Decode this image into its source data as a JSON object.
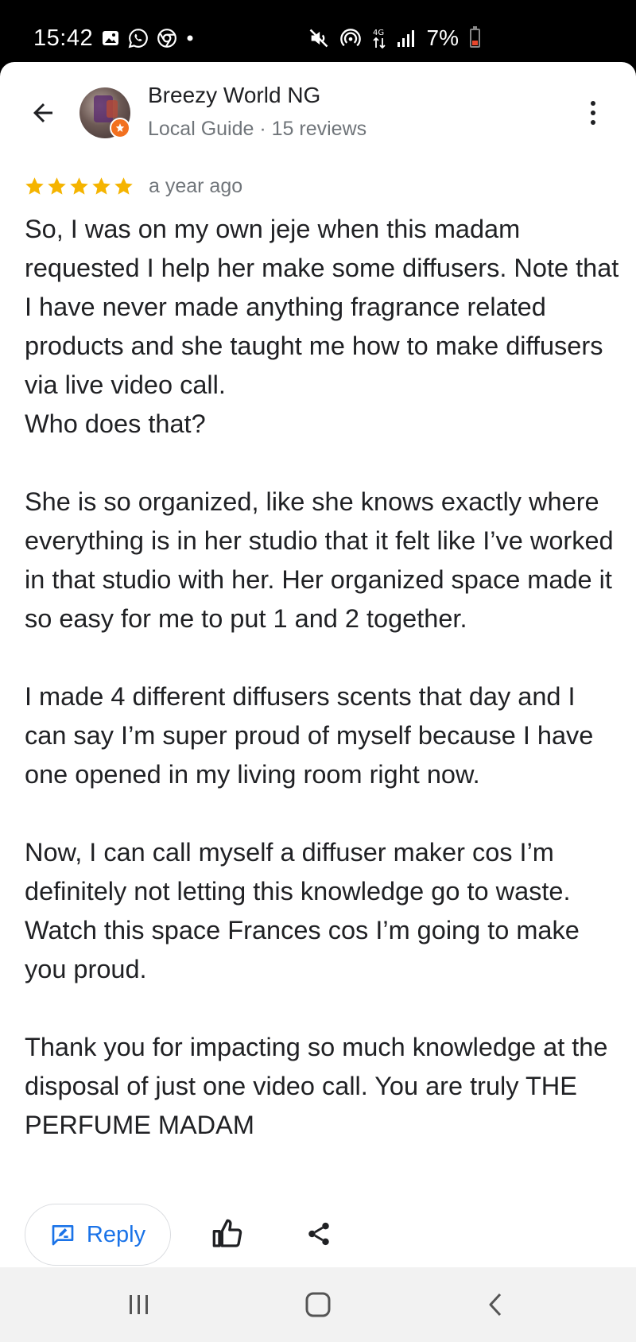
{
  "status_bar": {
    "time": "15:42",
    "battery": "7%",
    "icons_left": [
      "gallery-icon",
      "whatsapp-icon",
      "chrome-icon",
      "dot-icon"
    ],
    "icons_right": [
      "mute-icon",
      "hotspot-icon",
      "data-4g-icon",
      "signal-icon",
      "battery-icon"
    ],
    "battery_color": "#e8472d"
  },
  "reviewer": {
    "name": "Breezy World NG",
    "meta": "Local Guide · 15 reviews",
    "badge_color": "#f2701f"
  },
  "review": {
    "rating": 5,
    "max_rating": 5,
    "star_color": "#f5b400",
    "time": "a year ago",
    "paragraphs": [
      "So, I was on my own jeje when this madam requested I help her make some diffusers. Note that I have never made anything fragrance related products and she taught me how to make diffusers via live video call.\nWho does that?",
      "She is so organized, like she knows exactly where everything is in her studio that it felt like I’ve worked in that studio with her. Her organized space made it so easy for me to put 1 and 2 together.",
      "I made 4 different diffusers scents that day and I can say I’m super proud of myself because I have one opened in my living room right now.",
      "Now, I can call myself a diffuser maker cos I’m definitely not letting this knowledge go to waste. Watch this space Frances cos I’m going to make you proud.",
      "Thank you for impacting so much knowledge at the disposal of just one video call. You are truly THE PERFUME MADAM"
    ]
  },
  "actions": {
    "reply_label": "Reply",
    "accent_color": "#1a73e8"
  },
  "nav": {
    "buttons": [
      "recent-apps-icon",
      "home-icon",
      "back-nav-icon"
    ]
  }
}
